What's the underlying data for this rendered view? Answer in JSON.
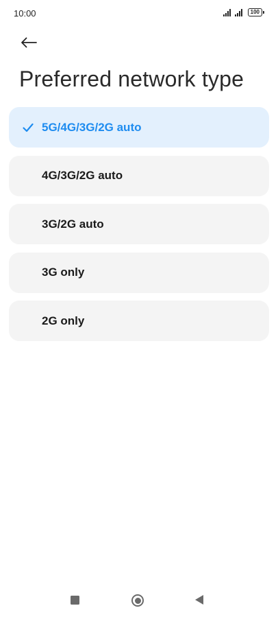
{
  "status_bar": {
    "time": "10:00",
    "battery": "100"
  },
  "header": {
    "back_icon": "arrow-left-icon",
    "title": "Preferred network type"
  },
  "options": [
    {
      "label": "5G/4G/3G/2G auto",
      "selected": true
    },
    {
      "label": "4G/3G/2G auto",
      "selected": false
    },
    {
      "label": "3G/2G auto",
      "selected": false
    },
    {
      "label": "3G only",
      "selected": false
    },
    {
      "label": "2G only",
      "selected": false
    }
  ],
  "check_icon": "checkmark-icon",
  "nav_bar": {
    "recent_icon": "square-recents-icon",
    "home_icon": "circle-home-icon",
    "back_icon": "triangle-back-icon"
  },
  "colors": {
    "accent": "#1e8cf0",
    "selected_bg": "#e3f0fd",
    "option_bg": "#f4f4f4"
  }
}
